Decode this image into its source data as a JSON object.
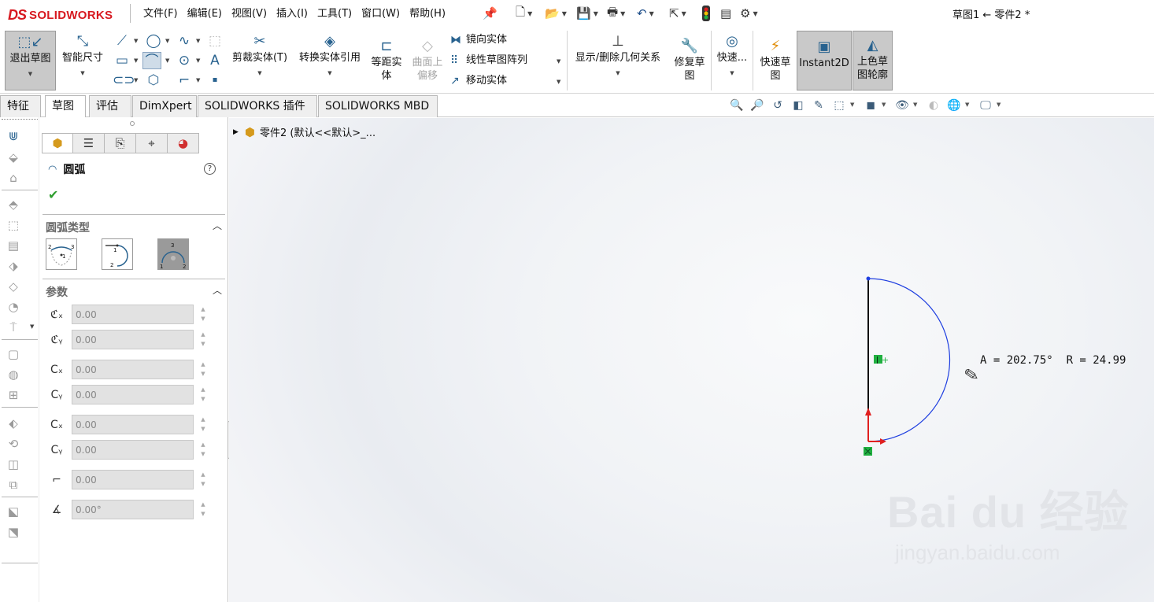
{
  "app": {
    "brand": "SOLIDWORKS",
    "brand_mark": "DS",
    "document_title": "草图1 ← 零件2 *"
  },
  "menu": [
    "文件(F)",
    "编辑(E)",
    "视图(V)",
    "插入(I)",
    "工具(T)",
    "窗口(W)",
    "帮助(H)"
  ],
  "quick_access": [
    "pin-icon",
    "new-doc-icon",
    "open-icon",
    "save-icon",
    "print-icon",
    "undo-icon",
    "select-icon",
    "rebuild-icon",
    "file-properties-icon",
    "options-icon"
  ],
  "ribbon": {
    "exit_sketch": "退出草图",
    "smart_dim": "智能尺寸",
    "trim": "剪裁实体(T)",
    "convert": "转换实体引用",
    "offset_line1": "等距实",
    "offset_line2": "体",
    "surface_offset_line1": "曲面上",
    "surface_offset_line2": "偏移",
    "mirror": "镜向实体",
    "linear_pattern": "线性草图阵列",
    "move": "移动实体",
    "show_delete_relations": "显示/删除几何关系",
    "repair_line1": "修复草",
    "repair_line2": "图",
    "quick_snaps": "快速...",
    "rapid_sketch_line1": "快速草",
    "rapid_sketch_line2": "图",
    "instant2d": "Instant2D",
    "shaded_line1": "上色草",
    "shaded_line2": "图轮廓"
  },
  "tabs": [
    "特征",
    "草图",
    "评估",
    "DimXpert",
    "SOLIDWORKS 插件",
    "SOLIDWORKS MBD"
  ],
  "active_tab": "草图",
  "property_manager": {
    "title": "圆弧",
    "help": "?",
    "ok_symbol": "✔",
    "section_arc_type": "圆弧类型",
    "section_params": "参数",
    "arc_types": [
      "centerpoint-arc",
      "tangent-arc",
      "3-point-arc"
    ],
    "selected_arc_type": "3-point-arc",
    "params": [
      {
        "name": "center-x",
        "value": "0.00"
      },
      {
        "name": "center-y",
        "value": "0.00"
      },
      {
        "name": "start-x",
        "value": "0.00"
      },
      {
        "name": "start-y",
        "value": "0.00"
      },
      {
        "name": "end-x",
        "value": "0.00"
      },
      {
        "name": "end-y",
        "value": "0.00"
      },
      {
        "name": "radius",
        "value": "0.00"
      },
      {
        "name": "angle",
        "value": "0.00°"
      }
    ]
  },
  "tree": {
    "root": "零件2  (默认<<默认>_..."
  },
  "sketch": {
    "readout": "A = 202.75°  R = 24.99",
    "arc_color": "#1f3fe0",
    "line_color": "#111111",
    "origin_x_color": "#e02020",
    "origin_y_color": "#e02020",
    "relation_color": "#20b040"
  },
  "watermark": {
    "brand": "Bai du 经验",
    "url": "jingyan.baidu.com"
  },
  "colors": {
    "accent": "#28628f",
    "brand": "#d71920"
  }
}
